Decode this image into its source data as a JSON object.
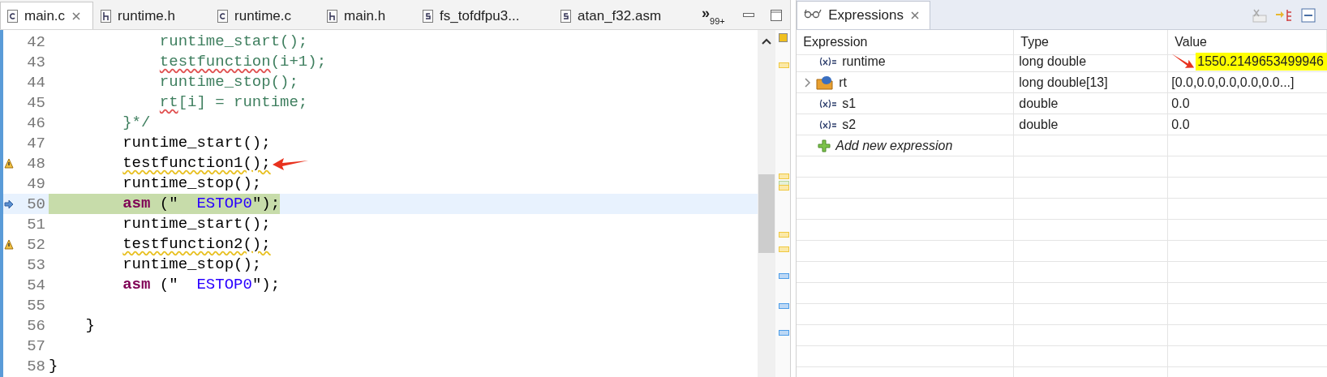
{
  "editor": {
    "tabs": [
      {
        "label": "main.c",
        "kind": "c",
        "selected": true
      },
      {
        "label": "runtime.h",
        "kind": "h",
        "selected": false
      },
      {
        "label": "runtime.c",
        "kind": "c",
        "selected": false
      },
      {
        "label": "main.h",
        "kind": "h",
        "selected": false
      },
      {
        "label": "fs_tofdfpu3...",
        "kind": "s",
        "selected": false
      },
      {
        "label": "atan_f32.asm",
        "kind": "s",
        "selected": false
      }
    ],
    "overflow": {
      "glyph": "»",
      "count": "99+"
    },
    "lines": [
      {
        "number": "42",
        "warning": false,
        "current": false,
        "segments": [
          {
            "text": "            runtime_start();",
            "kind": "comment",
            "misspelled": false,
            "warned": false
          }
        ]
      },
      {
        "number": "43",
        "warning": false,
        "current": false,
        "segments": [
          {
            "text": "            testfunction",
            "kind": "comment",
            "misspelled": true,
            "warned": false
          },
          {
            "text": "(i+1);",
            "kind": "comment",
            "misspelled": false,
            "warned": false
          }
        ]
      },
      {
        "number": "44",
        "warning": false,
        "current": false,
        "segments": [
          {
            "text": "            runtime_stop();",
            "kind": "comment",
            "misspelled": false,
            "warned": false
          }
        ]
      },
      {
        "number": "45",
        "warning": false,
        "current": false,
        "segments": [
          {
            "text": "            rt",
            "kind": "comment",
            "misspelled": true,
            "warned": false
          },
          {
            "text": "[i] = runtime;",
            "kind": "comment",
            "misspelled": false,
            "warned": false
          }
        ]
      },
      {
        "number": "46",
        "warning": false,
        "current": false,
        "segments": [
          {
            "text": "        }*/",
            "kind": "comment",
            "misspelled": false,
            "warned": false
          }
        ]
      },
      {
        "number": "47",
        "warning": false,
        "current": false,
        "segments": [
          {
            "text": "        runtime_start();",
            "kind": "plain",
            "misspelled": false,
            "warned": false
          }
        ]
      },
      {
        "number": "48",
        "warning": true,
        "current": false,
        "segments": [
          {
            "text": "        testfunction1();",
            "kind": "plain",
            "misspelled": false,
            "warned": true
          }
        ]
      },
      {
        "number": "49",
        "warning": false,
        "current": false,
        "segments": [
          {
            "text": "        runtime_stop();",
            "kind": "plain",
            "misspelled": false,
            "warned": false
          }
        ]
      },
      {
        "number": "50",
        "warning": false,
        "current": true,
        "segments": [
          {
            "text": "        asm",
            "kind": "keyword",
            "misspelled": false,
            "warned": false
          },
          {
            "text": " (\"  ",
            "kind": "plain",
            "misspelled": false,
            "warned": false
          },
          {
            "text": "ESTOP0",
            "kind": "string",
            "misspelled": false,
            "warned": false
          },
          {
            "text": "\");",
            "kind": "plain",
            "misspelled": false,
            "warned": false
          }
        ]
      },
      {
        "number": "51",
        "warning": false,
        "current": false,
        "segments": [
          {
            "text": "        runtime_start();",
            "kind": "plain",
            "misspelled": false,
            "warned": false
          }
        ]
      },
      {
        "number": "52",
        "warning": true,
        "current": false,
        "segments": [
          {
            "text": "        testfunction2();",
            "kind": "plain",
            "misspelled": false,
            "warned": true
          }
        ]
      },
      {
        "number": "53",
        "warning": false,
        "current": false,
        "segments": [
          {
            "text": "        runtime_stop();",
            "kind": "plain",
            "misspelled": false,
            "warned": false
          }
        ]
      },
      {
        "number": "54",
        "warning": false,
        "current": false,
        "segments": [
          {
            "text": "        asm",
            "kind": "keyword",
            "misspelled": false,
            "warned": false
          },
          {
            "text": " (\"  ",
            "kind": "plain",
            "misspelled": false,
            "warned": false
          },
          {
            "text": "ESTOP0",
            "kind": "string",
            "misspelled": false,
            "warned": false
          },
          {
            "text": "\");",
            "kind": "plain",
            "misspelled": false,
            "warned": false
          }
        ]
      },
      {
        "number": "55",
        "warning": false,
        "current": false
      },
      {
        "number": "56",
        "warning": false,
        "current": false,
        "segments": [
          {
            "text": "    }",
            "kind": "plain",
            "misspelled": false,
            "warned": false
          }
        ]
      },
      {
        "number": "57",
        "warning": false,
        "current": false
      },
      {
        "number": "58",
        "warning": false,
        "current": false,
        "segments": [
          {
            "text": "}",
            "kind": "plain",
            "misspelled": false,
            "warned": false
          }
        ]
      }
    ]
  },
  "expressions": {
    "tab": {
      "label": "Expressions",
      "selected": true
    },
    "columns": [
      "Expression",
      "Type",
      "Value"
    ],
    "rows": [
      {
        "kind": "variable",
        "expression": "runtime",
        "type": "long double",
        "value": "1550.2149653499946",
        "highlighted": true
      },
      {
        "kind": "array",
        "expression": "rt",
        "type": "long double[13]",
        "value": "[0.0,0.0,0.0,0.0,0.0...]",
        "highlighted": false,
        "expanded": false
      },
      {
        "kind": "variable",
        "expression": "s1",
        "type": "double",
        "value": "0.0",
        "highlighted": false
      },
      {
        "kind": "variable",
        "expression": "s2",
        "type": "double",
        "value": "0.0",
        "highlighted": false
      },
      {
        "kind": "add",
        "expression": "Add new expression"
      }
    ]
  }
}
